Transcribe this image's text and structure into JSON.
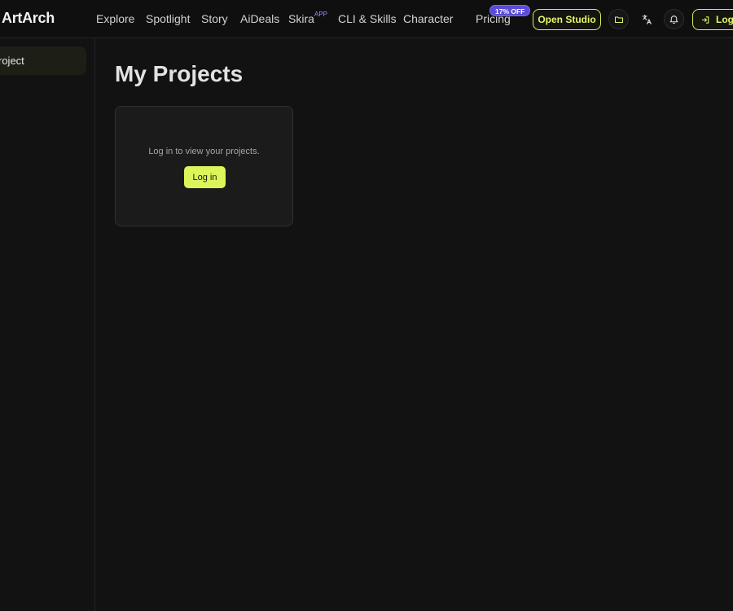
{
  "header": {
    "logo": "ArtArch",
    "nav": [
      {
        "label": "Explore"
      },
      {
        "label": "Spotlight"
      },
      {
        "label": "Story"
      },
      {
        "label": "AiDeals"
      },
      {
        "label": "Skira",
        "sup": "APP"
      },
      {
        "label": "CLI & Skills"
      },
      {
        "label": "Character"
      },
      {
        "label": "Pricing"
      }
    ],
    "pricing_badge": "17% OFF",
    "open_studio_label": "Open Studio",
    "login_label": "Log",
    "icons": [
      "folder-icon",
      "translate-icon",
      "bell-icon",
      "login-icon"
    ]
  },
  "sidebar": {
    "items": [
      {
        "label": "roject",
        "active": true
      }
    ]
  },
  "main": {
    "title": "My Projects",
    "empty_card": {
      "message": "Log in to view your projects.",
      "button_label": "Log in"
    }
  },
  "colors": {
    "background": "#121212",
    "accent": "#dcf55a",
    "badge": "#5b4cd6"
  }
}
